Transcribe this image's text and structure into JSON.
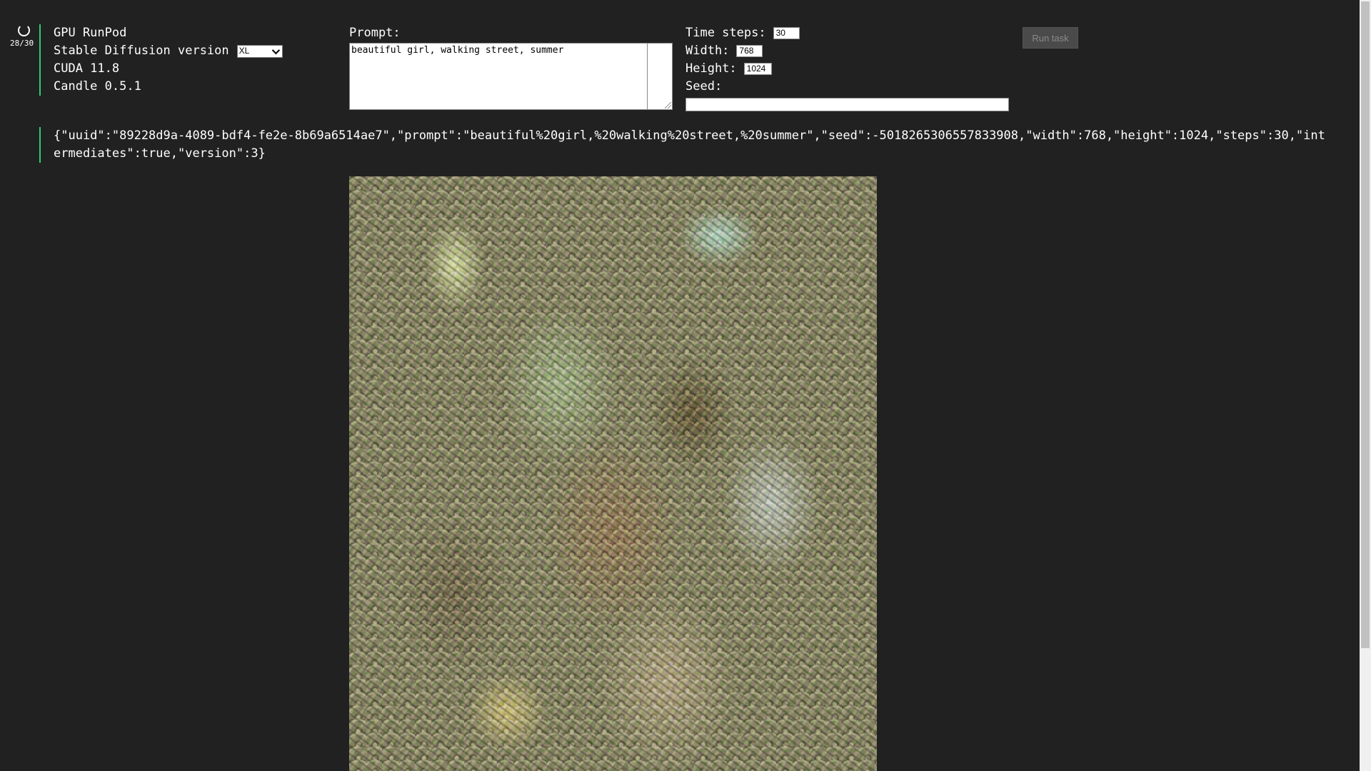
{
  "progress": {
    "count_text": "28/30"
  },
  "system": {
    "gpu": "GPU RunPod",
    "sd_version_label": "Stable Diffusion version",
    "sd_version_selected": "XL",
    "cuda": "CUDA 11.8",
    "candle": "Candle 0.5.1"
  },
  "prompt": {
    "label": "Prompt:",
    "value": "beautiful girl, walking street, summer"
  },
  "params": {
    "steps_label": "Time steps:",
    "steps_value": "30",
    "width_label": "Width:",
    "width_value": "768",
    "height_label": "Height:",
    "height_value": "1024",
    "seed_label": "Seed:",
    "seed_value": ""
  },
  "run_button": {
    "label": "Run task"
  },
  "output": {
    "json_text": "{\"uuid\":\"89228d9a-4089-bdf4-fe2e-8b69a6514ae7\",\"prompt\":\"beautiful%20girl,%20walking%20street,%20summer\",\"seed\":-5018265306557833908,\"width\":768,\"height\":1024,\"steps\":30,\"intermediates\":true,\"version\":3}"
  },
  "colors": {
    "background": "#212121",
    "accent_border": "#2ecc71"
  }
}
